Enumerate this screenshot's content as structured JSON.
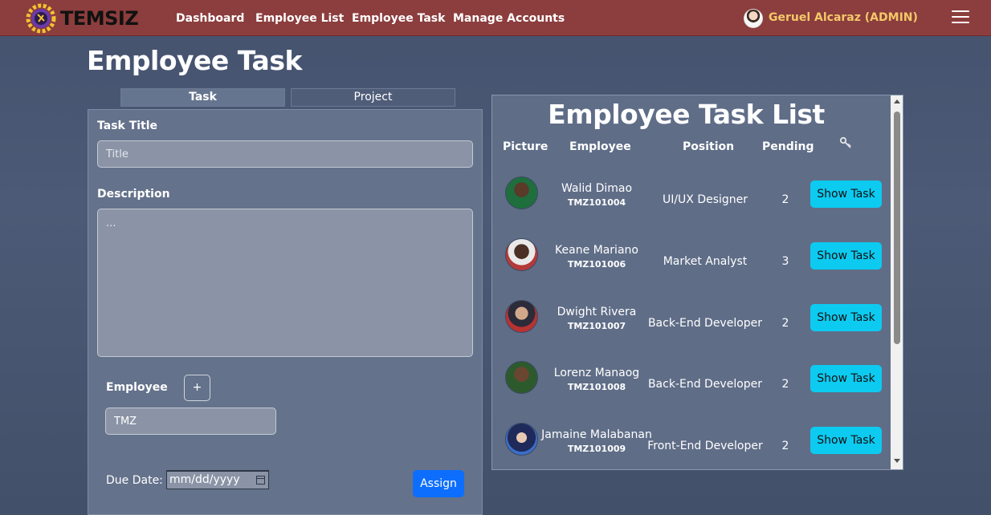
{
  "brand": {
    "name": "TEMSIZ"
  },
  "nav": {
    "links": [
      "Dashboard",
      "Employee List",
      "Employee Task",
      "Manage Accounts"
    ],
    "user": "Geruel Alcaraz (ADMIN)"
  },
  "page_title": "Employee Task",
  "tabs": [
    "Task",
    "Project"
  ],
  "form": {
    "task_title_label": "Task Title",
    "title_placeholder": "Title",
    "description_label": "Description",
    "description_placeholder": "...",
    "employee_label": "Employee",
    "add_label": "+",
    "employee_value": "TMZ",
    "due_date_label": "Due Date:",
    "due_date_placeholder": "mm/dd/yyyy",
    "assign_label": "Assign"
  },
  "task_list": {
    "title": "Employee Task List",
    "columns": [
      "Picture",
      "Employee",
      "Position",
      "Pending"
    ],
    "button_label": "Show Task",
    "rows": [
      {
        "name": "Walid Dimao",
        "id": "TMZ101004",
        "position": "UI/UX Designer",
        "pending": "2"
      },
      {
        "name": "Keane Mariano",
        "id": "TMZ101006",
        "position": "Market Analyst",
        "pending": "3"
      },
      {
        "name": "Dwight Rivera",
        "id": "TMZ101007",
        "position": "Back-End Developer",
        "pending": "2"
      },
      {
        "name": "Lorenz Manaog",
        "id": "TMZ101008",
        "position": "Back-End Developer",
        "pending": "2"
      },
      {
        "name": "Jamaine Malabanan",
        "id": "TMZ101009",
        "position": "Front-End Developer",
        "pending": "2"
      }
    ]
  },
  "colors": {
    "navbar": "#8c3d3d",
    "accent_user": "#f3c969",
    "assign_button": "#0d6efd",
    "show_task_button": "#0dcaf0"
  }
}
